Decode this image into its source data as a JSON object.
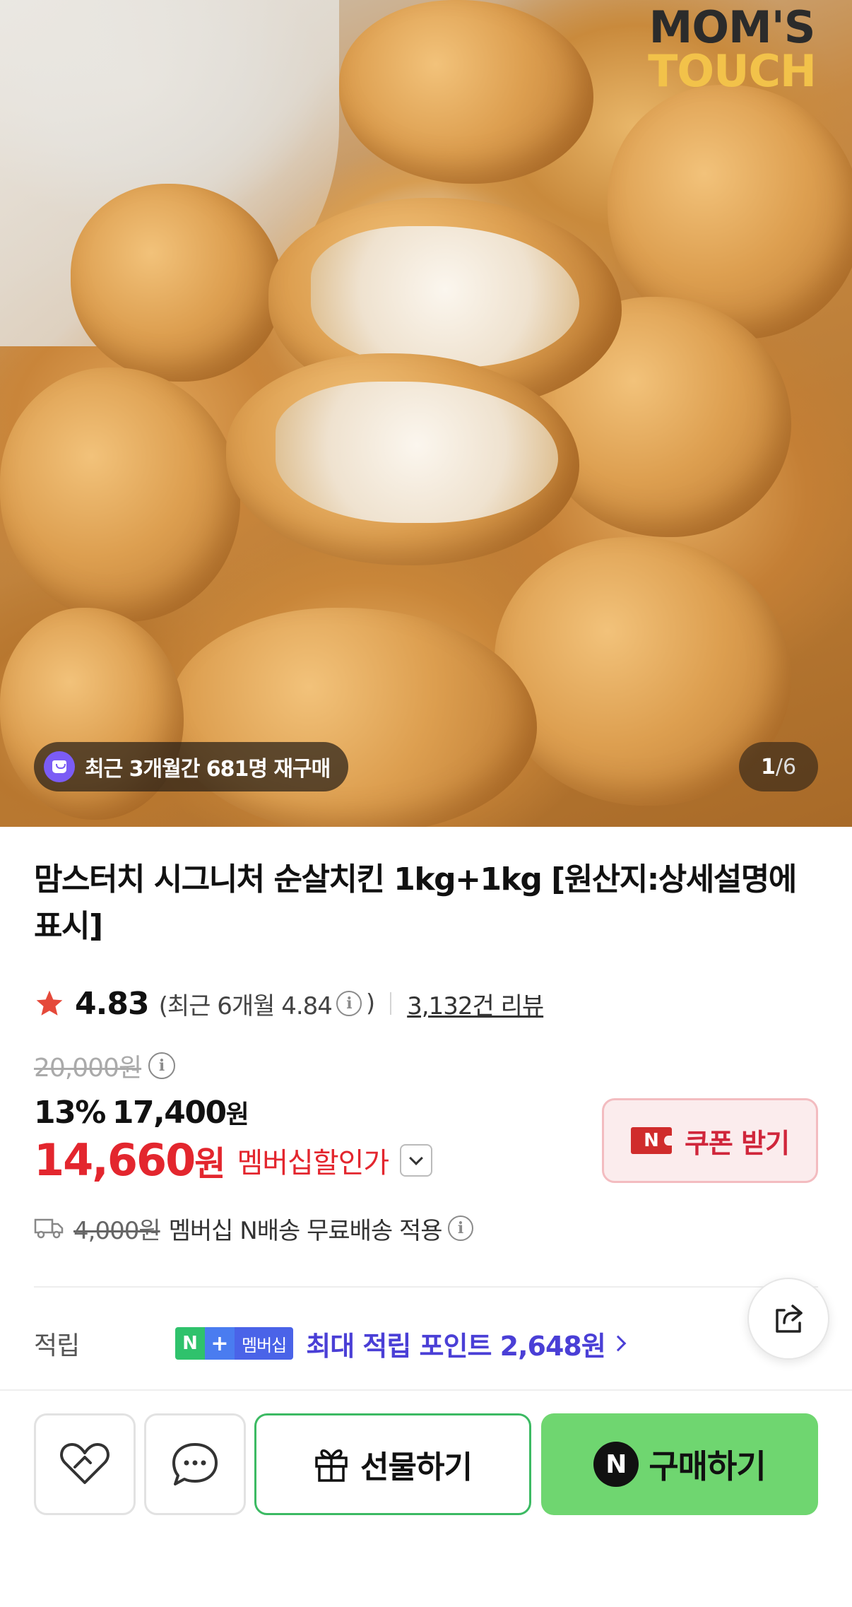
{
  "hero": {
    "brand_logo_line1": "MOM'S",
    "brand_logo_line2": "TOUCH",
    "repurchase_text": "최근 3개월간 681명 재구매",
    "image_index": "1",
    "image_separator": "/",
    "image_total": "6"
  },
  "product": {
    "title": "맘스터치 시그니처 순살치킨 1kg+1kg [원산지:상세설명에 표시]"
  },
  "rating": {
    "score": "4.83",
    "recent_prefix": "(최근 6개월 4.84",
    "recent_suffix": ")",
    "review_count": "3,132건 리뷰",
    "star_color": "#e5493a"
  },
  "price": {
    "original": "20,000원",
    "discount_percent": "13%",
    "sale_price": "17,400",
    "sale_unit": "원",
    "member_price": "14,660",
    "member_unit": "원",
    "member_label": "멤버십할인가",
    "coupon_label": "쿠폰 받기",
    "coupon_badge": "N"
  },
  "shipping": {
    "fee": "4,000원",
    "text": "멤버십 N배송 무료배송 적용"
  },
  "points": {
    "label": "적립",
    "badge_n": "N",
    "badge_plus": "+",
    "badge_text": "멤버십",
    "text": "최대 적립 포인트 2,648원"
  },
  "actions": {
    "gift_label": "선물하기",
    "buy_label": "구매하기",
    "buy_badge": "N",
    "buy_color": "#6fd670",
    "gift_border_color": "#3cba63"
  },
  "icons": {
    "info": "i",
    "wishlist": "heart-icon",
    "chat": "chat-icon",
    "share": "share-icon",
    "gift": "gift-icon",
    "truck": "truck-icon",
    "repurchase": "shopping-bag-icon"
  }
}
